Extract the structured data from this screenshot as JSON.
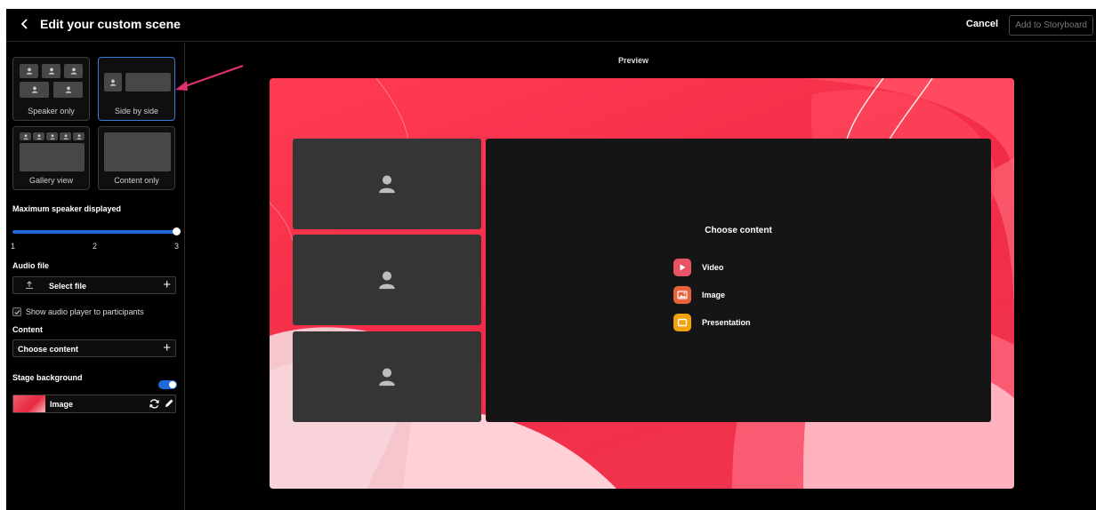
{
  "header": {
    "title": "Edit your custom scene",
    "cancel_label": "Cancel",
    "add_to_storyboard_label": "Add to Storyboard"
  },
  "sidebar": {
    "layouts": [
      {
        "label": "Speaker only",
        "selected": false
      },
      {
        "label": "Side by side",
        "selected": true
      },
      {
        "label": "Gallery view",
        "selected": false
      },
      {
        "label": "Content only",
        "selected": false
      }
    ],
    "max_speaker": {
      "label": "Maximum speaker displayed",
      "ticks": [
        "1",
        "2",
        "3"
      ],
      "value": 3
    },
    "audio": {
      "label": "Audio file",
      "select_label": "Select file",
      "show_player_label": "Show audio player to participants",
      "show_player_checked": true
    },
    "content": {
      "label": "Content",
      "choose_label": "Choose content"
    },
    "stage_background": {
      "label": "Stage background",
      "enabled": true,
      "value_label": "Image"
    }
  },
  "preview": {
    "title": "Preview",
    "choose_content_title": "Choose content",
    "options": [
      {
        "label": "Video",
        "color": "#e85466",
        "icon": "play-icon"
      },
      {
        "label": "Image",
        "color": "#e8633a",
        "icon": "image-icon"
      },
      {
        "label": "Presentation",
        "color": "#f2a20c",
        "icon": "presentation-icon"
      }
    ]
  },
  "colors": {
    "accent": "#1f6ad8",
    "stage": "#f22c47"
  }
}
